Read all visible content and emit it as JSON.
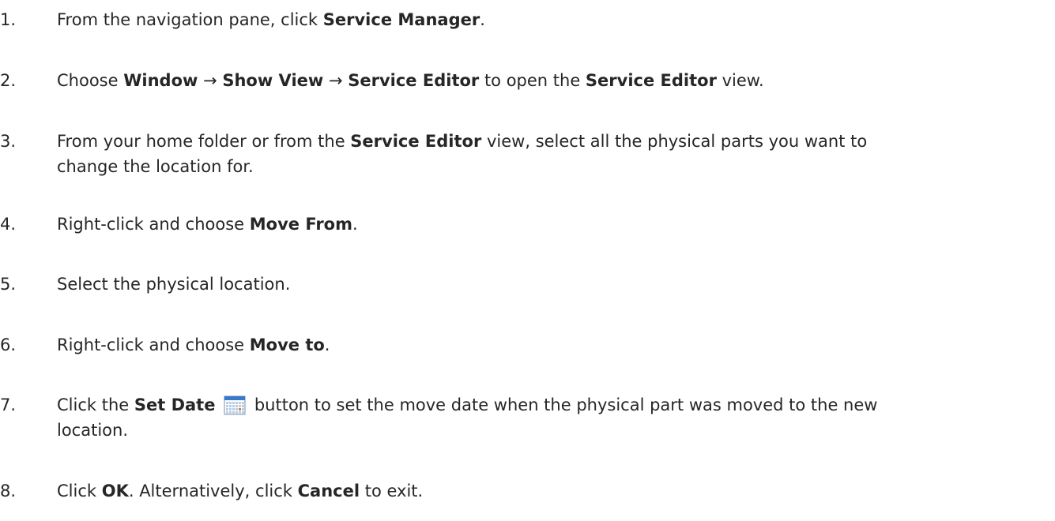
{
  "steps": [
    {
      "number": "1.",
      "lines": [
        [
          {
            "t": "From the navigation pane, click "
          },
          {
            "t": "Service Manager",
            "b": true
          },
          {
            "t": "."
          }
        ]
      ]
    },
    {
      "number": "2.",
      "lines": [
        [
          {
            "t": "Choose "
          },
          {
            "t": "Window",
            "b": true
          },
          {
            "t": " → "
          },
          {
            "t": "Show View",
            "b": true
          },
          {
            "t": " → "
          },
          {
            "t": "Service Editor",
            "b": true
          },
          {
            "t": " to open the "
          },
          {
            "t": "Service Editor",
            "b": true
          },
          {
            "t": " view."
          }
        ]
      ]
    },
    {
      "number": "3.",
      "lines": [
        [
          {
            "t": "From your home folder or from the "
          },
          {
            "t": "Service Editor",
            "b": true
          },
          {
            "t": " view, select all the physical parts you want to"
          }
        ],
        [
          {
            "t": "change the location for."
          }
        ]
      ]
    },
    {
      "number": "4.",
      "lines": [
        [
          {
            "t": "Right-click and choose "
          },
          {
            "t": "Move From",
            "b": true
          },
          {
            "t": "."
          }
        ]
      ]
    },
    {
      "number": "5.",
      "lines": [
        [
          {
            "t": "Select the physical location."
          }
        ]
      ]
    },
    {
      "number": "6.",
      "lines": [
        [
          {
            "t": "Right-click and choose "
          },
          {
            "t": "Move to",
            "b": true
          },
          {
            "t": "."
          }
        ]
      ]
    },
    {
      "number": "7.",
      "lines": [
        [
          {
            "t": "Click the "
          },
          {
            "t": "Set Date",
            "b": true
          },
          {
            "t": " "
          },
          {
            "icon": "calendar-icon"
          },
          {
            "t": " button to set the move date when the physical part was moved to the new"
          }
        ],
        [
          {
            "t": "location."
          }
        ]
      ]
    },
    {
      "number": "8.",
      "lines": [
        [
          {
            "t": "Click "
          },
          {
            "t": "OK",
            "b": true
          },
          {
            "t": ". Alternatively, click "
          },
          {
            "t": "Cancel",
            "b": true
          },
          {
            "t": " to exit."
          }
        ]
      ]
    }
  ],
  "colors": {
    "text": "#262626",
    "calendar_header": "#3a78c8",
    "calendar_marker": "#e87a1e"
  }
}
